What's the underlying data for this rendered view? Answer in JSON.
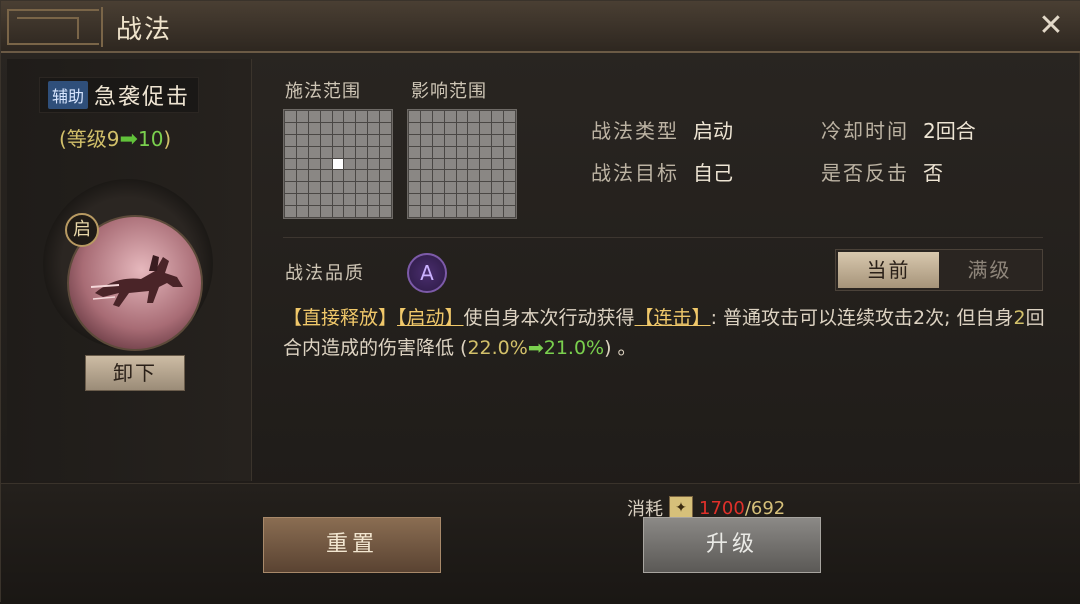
{
  "title": "战法",
  "close_icon": "close-icon",
  "left": {
    "tag": "辅助",
    "skill_name": "急袭促击",
    "level_prefix": "(等级9",
    "level_arrow": "➡",
    "level_new": "10",
    "level_suffix": ")",
    "badge": "启",
    "unequip_label": "卸下"
  },
  "ranges": {
    "cast_label": "施法范围",
    "effect_label": "影响范围"
  },
  "info": {
    "type_key": "战法类型",
    "type_val": "启动",
    "cooldown_key": "冷却时间",
    "cooldown_val": "2回合",
    "target_key": "战法目标",
    "target_val": "自己",
    "counter_key": "是否反击",
    "counter_val": "否"
  },
  "quality": {
    "label": "战法品质",
    "grade": "A"
  },
  "toggle": {
    "current": "当前",
    "max": "满级"
  },
  "desc": {
    "p1": "【直接释放】",
    "p2": "【启动】",
    "p3": "使自身本次行动获得",
    "p4": "【连击】",
    "p5": ": 普通攻击可以连续攻击2次; 但自身",
    "p6": "2",
    "p7": "回合内造成的伤害降低 (",
    "p8": "22.0%",
    "p9": "➡",
    "p10": "21.0%",
    "p11": ") 。"
  },
  "bottom": {
    "reset_label": "重置",
    "upgrade_label": "升级",
    "cost_label": "消耗",
    "cost_need": "1700",
    "cost_sep": "/",
    "cost_have": "692"
  }
}
